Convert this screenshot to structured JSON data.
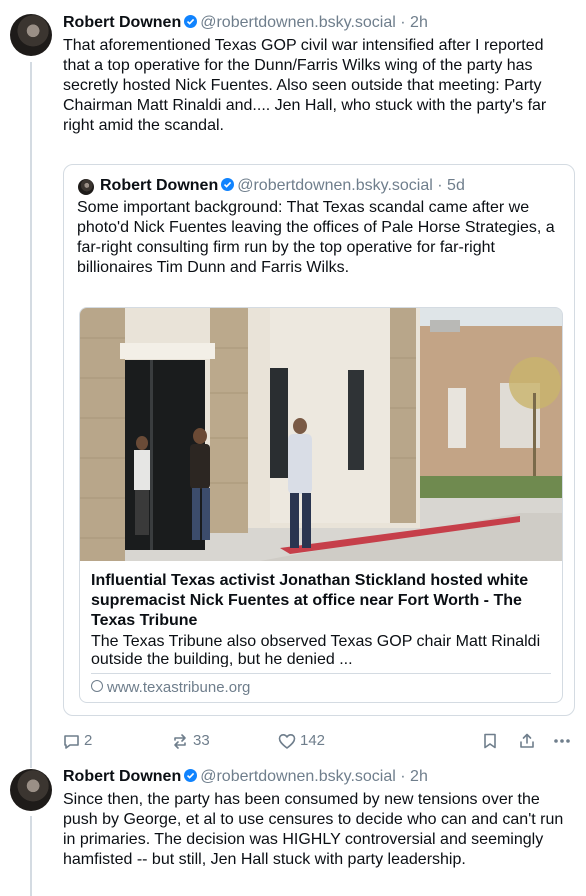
{
  "posts": [
    {
      "author": "Robert Downen",
      "handle": "@robertdownen.bsky.social",
      "separator": "·",
      "time": "2h",
      "text": "That aforementioned Texas GOP civil war intensified after I reported that a top operative for the Dunn/Farris Wilks wing of the party has secretly hosted Nick Fuentes. Also seen outside that meeting: Party Chairman Matt Rinaldi and.... Jen Hall, who stuck with the party's far right amid the scandal.",
      "quote": {
        "author": "Robert Downen",
        "handle": "@robertdownen.bsky.social",
        "separator": "·",
        "time": "5d",
        "text": "Some important background: That Texas scandal came after we photo'd Nick Fuentes leaving the offices of Pale Horse Strategies, a far-right consulting firm run by the top operative for far-right billionaires Tim Dunn and Farris Wilks.",
        "link_card": {
          "title": "Influential Texas activist Jonathan Stickland hosted white supremacist Nick Fuentes at office near Fort Worth - The Texas Tribune",
          "description": "The Texas Tribune also observed Texas GOP chair Matt Rinaldi outside the building, but he denied ...",
          "url": "www.texastribune.org"
        }
      },
      "counts": {
        "replies": "2",
        "reposts": "33",
        "likes": "142"
      }
    },
    {
      "author": "Robert Downen",
      "handle": "@robertdownen.bsky.social",
      "separator": "·",
      "time": "2h",
      "text": "Since then, the party has been consumed by new tensions over the push by George, et al to use censures to decide who can and can't run in primaries. The decision was HIGHLY controversial and seemingly hamfisted -- but still, Jen Hall stuck with party leadership."
    }
  ],
  "colors": {
    "accent": "#1083fe",
    "muted": "#6f7e8c",
    "border": "#d4dbe2"
  }
}
